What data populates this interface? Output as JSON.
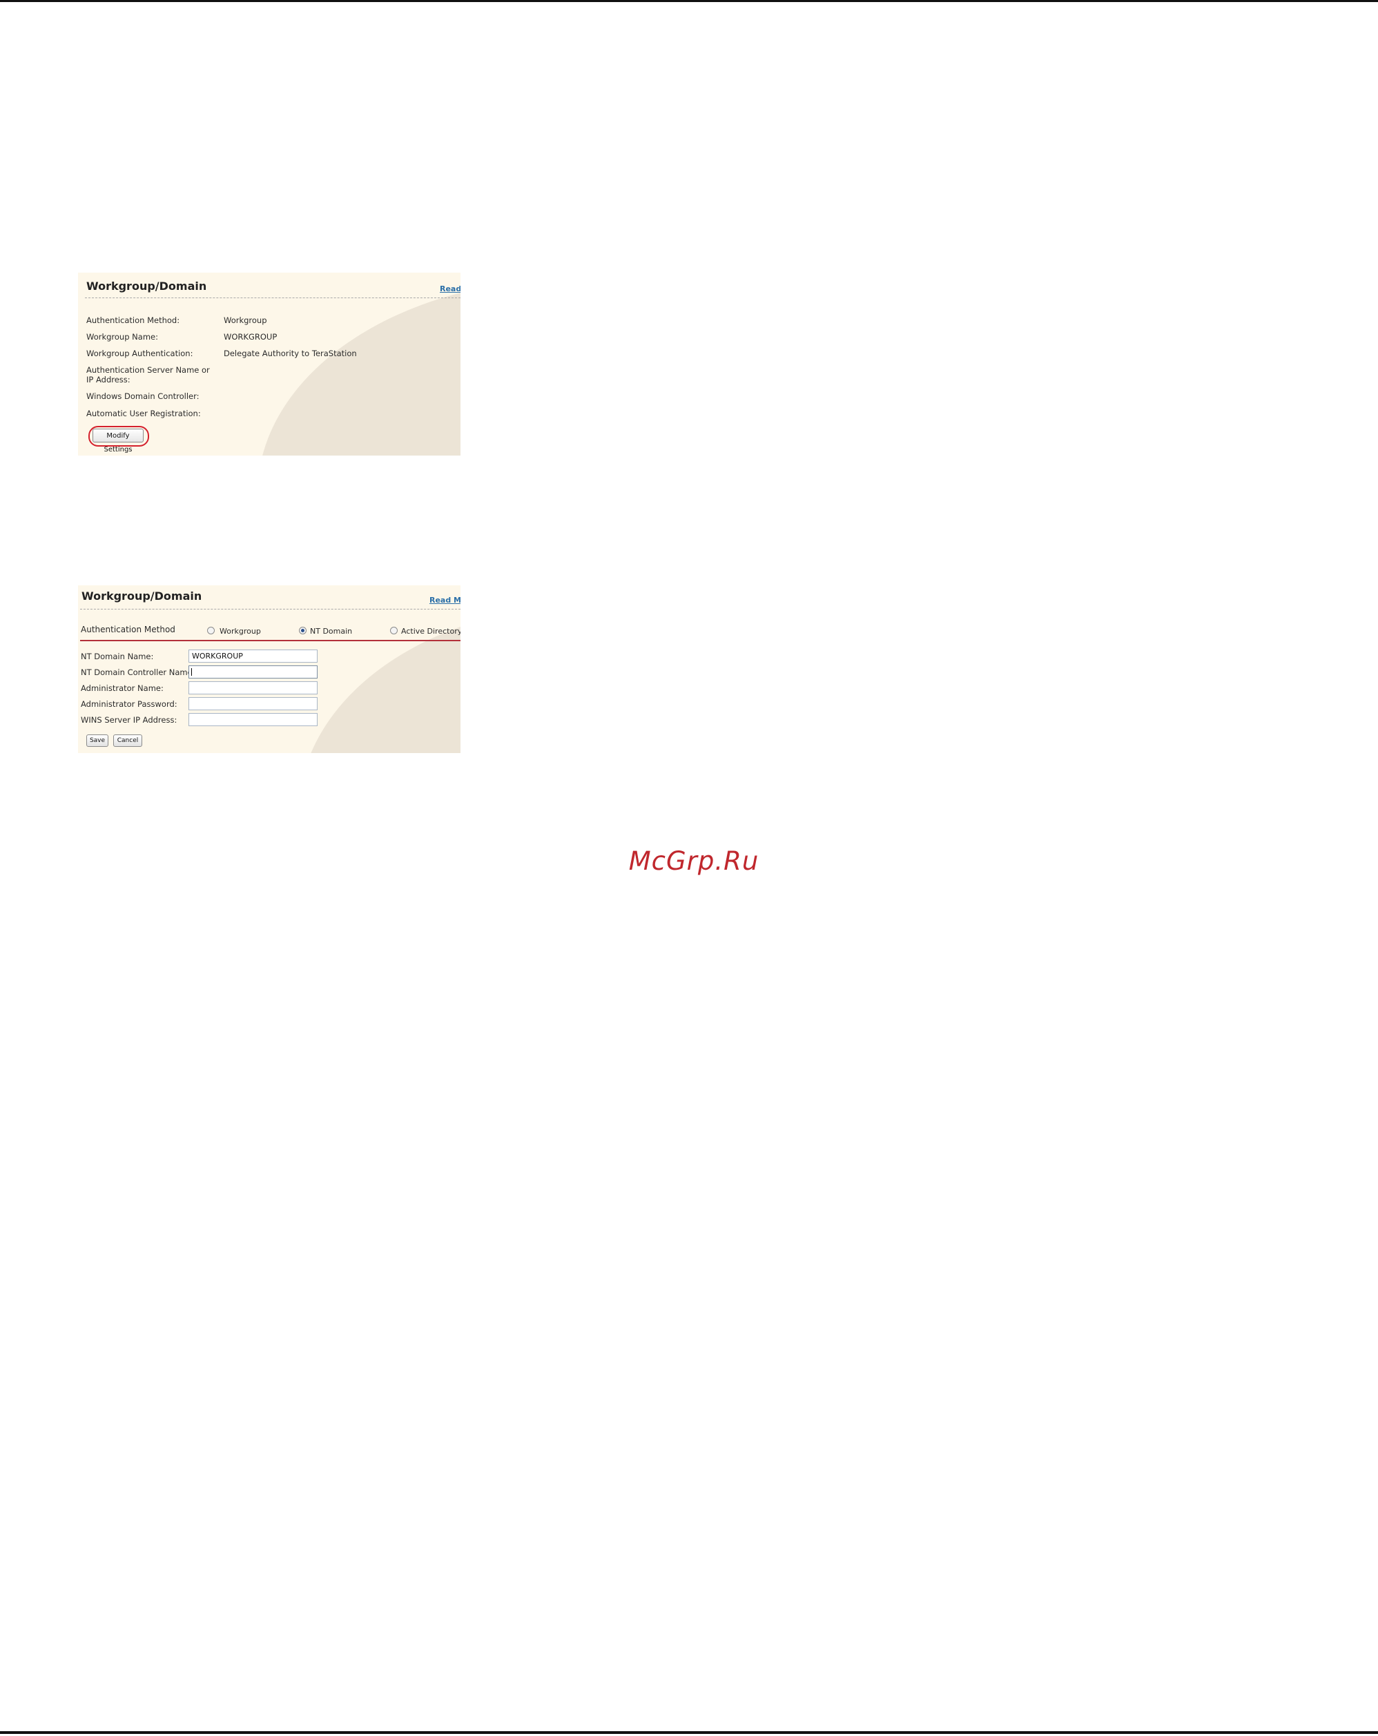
{
  "panel1": {
    "title": "Workgroup/Domain",
    "read_more": "Read",
    "rows": [
      {
        "label": "Authentication Method:",
        "value": "Workgroup"
      },
      {
        "label": "Workgroup Name:",
        "value": "WORKGROUP"
      },
      {
        "label": "Workgroup Authentication:",
        "value": "Delegate Authority to TeraStation"
      },
      {
        "label": "Authentication Server Name or IP Address:",
        "value": ""
      },
      {
        "label": "Windows Domain Controller:",
        "value": ""
      },
      {
        "label": "Automatic User Registration:",
        "value": ""
      }
    ],
    "modify_button": "Modify Settings"
  },
  "panel2": {
    "title": "Workgroup/Domain",
    "read_more": "Read Mo",
    "auth_method_label": "Authentication Method",
    "auth_options": [
      {
        "label": "Workgroup",
        "checked": false
      },
      {
        "label": "NT Domain",
        "checked": true
      },
      {
        "label": "Active Directory",
        "checked": false
      }
    ],
    "fields": [
      {
        "label": "NT Domain Name:",
        "value": "WORKGROUP"
      },
      {
        "label": "NT Domain Controller Name:",
        "value": ""
      },
      {
        "label": "Administrator Name:",
        "value": ""
      },
      {
        "label": "Administrator Password:",
        "value": ""
      },
      {
        "label": "WINS Server IP Address:",
        "value": ""
      }
    ],
    "save_button": "Save",
    "cancel_button": "Cancel"
  },
  "watermark": "McGrp.Ru",
  "colors": {
    "panel_bg": "#fdf7e9",
    "panel_swoosh": "#ece4d6",
    "link": "#2b6fa8",
    "highlight": "#d4202c",
    "separator": "#b3303a",
    "watermark": "#c0272d"
  }
}
